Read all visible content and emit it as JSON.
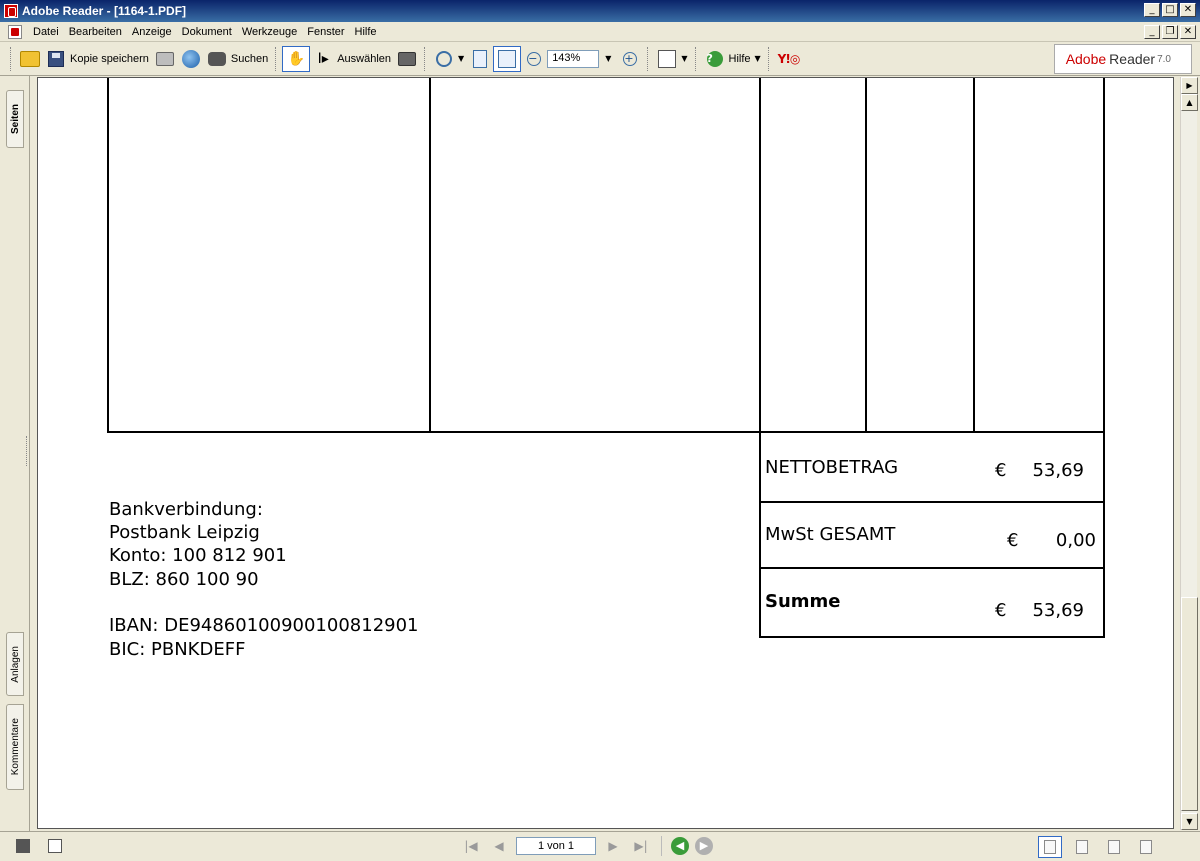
{
  "window": {
    "title": "Adobe Reader - [1164-1.PDF]",
    "controls": {
      "minimize": "_",
      "maximize": "□",
      "close": "✕",
      "restore": "❐"
    }
  },
  "menu": [
    {
      "label": "Datei"
    },
    {
      "label": "Bearbeiten"
    },
    {
      "label": "Anzeige"
    },
    {
      "label": "Dokument"
    },
    {
      "label": "Werkzeuge"
    },
    {
      "label": "Fenster"
    },
    {
      "label": "Hilfe"
    }
  ],
  "toolbar": {
    "save_copy": "Kopie speichern",
    "search": "Suchen",
    "select": "Auswählen",
    "zoom_value": "143%",
    "help": "Hilfe",
    "brand": {
      "name": "Adobe",
      "product": "Reader",
      "version": "7.0"
    }
  },
  "left_pane": {
    "tabs": [
      "Seiten",
      "Anlagen",
      "Kommentare"
    ]
  },
  "document": {
    "bank_details": {
      "heading": "Bankverbindung:",
      "bank": "Postbank Leipzig",
      "account": "Konto: 100 812 901",
      "blz": "BLZ: 860 100 90",
      "iban": "IBAN: DE94860100900100812901",
      "bic": "BIC: PBNKDEFF"
    },
    "totals": [
      {
        "label": "NETTOBETRAG",
        "currency": "€",
        "amount": "53,69",
        "bold": false
      },
      {
        "label": "MwSt GESAMT",
        "currency": "€",
        "amount": "0,00",
        "bold": false
      },
      {
        "label": "Summe",
        "currency": "€",
        "amount": "53,69",
        "bold": true
      }
    ]
  },
  "statusbar": {
    "page_field": "1 von 1"
  }
}
